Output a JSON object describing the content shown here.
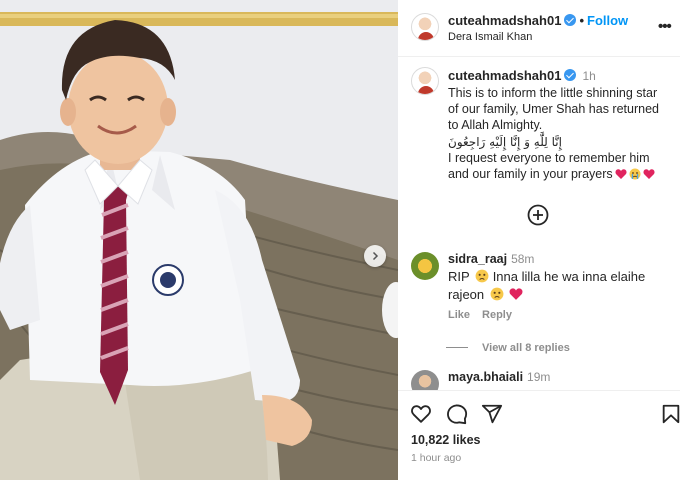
{
  "post": {
    "header": {
      "username": "cuteahmadshah01",
      "separator": "•",
      "follow_label": "Follow",
      "location": "Dera Ismail Khan",
      "more_label": "•••"
    },
    "caption": {
      "username": "cuteahmadshah01",
      "time": "1h",
      "lines": [
        "This is to inform the little shinning star",
        "of our family, Umer Shah has returned",
        "to Allah Almighty.",
        "إِنَّا لِلَّٰهِ وَ إِنَّا إِلَيْهِ رَاجِعُونَ",
        "I request everyone to remember him",
        "and our family in your prayers"
      ]
    },
    "comments": [
      {
        "username": "sidra_raaj",
        "time": "58m",
        "text_1": "RIP",
        "text_2": "Inna lilla he wa inna elaihe",
        "text_3": "rajeon",
        "like_label": "Like",
        "reply_label": "Reply"
      },
      {
        "username": "maya.bhaiali",
        "time": "19m"
      }
    ],
    "view_replies_label": "View all 8 replies",
    "likes": "10,822 likes",
    "timestamp": "1 hour ago"
  },
  "icons": {
    "verified": "verified-badge-icon",
    "add_comment": "plus-circle-icon",
    "like": "heart-icon",
    "comment": "comment-bubble-icon",
    "share": "paper-plane-icon",
    "save": "bookmark-icon",
    "carousel_next": "chevron-right-icon"
  },
  "colors": {
    "accent": "#0095f6",
    "verified": "#3897f0",
    "heart": "#e0245e",
    "text": "#262626",
    "muted": "#8e8e8e"
  }
}
